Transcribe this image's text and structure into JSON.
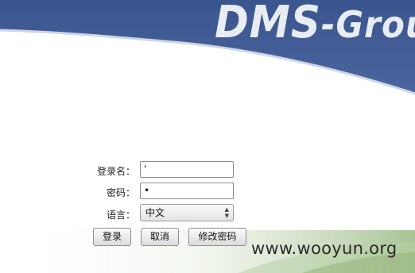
{
  "header": {
    "brand_primary": "DMS",
    "brand_secondary": "-Grou",
    "brand_color": "#3e5a92"
  },
  "login_form": {
    "username_label": "登录名：",
    "username_value": "'",
    "password_label": "密码：",
    "password_value": "•",
    "language_label": "语言：",
    "language_selected": "中文",
    "login_button": "登录",
    "cancel_button": "取消",
    "change_password_button": "修改密码"
  },
  "watermark": {
    "text": "www.wooyun.org"
  }
}
